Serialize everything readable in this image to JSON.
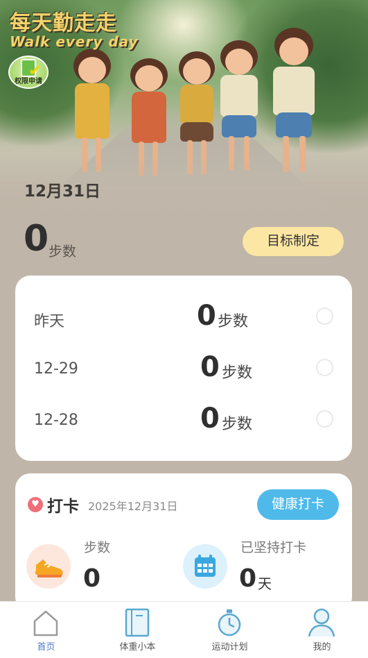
{
  "banner": {
    "title": "每天勤走走",
    "subtitle": "Walk every day",
    "permission_label": "权限申请",
    "date": "12月31日"
  },
  "today": {
    "steps": "0",
    "unit": "步数",
    "goal_button": "目标制定"
  },
  "history": [
    {
      "day": "昨天",
      "steps": "0",
      "unit": "步数"
    },
    {
      "day": "12-29",
      "steps": "0",
      "unit": "步数"
    },
    {
      "day": "12-28",
      "steps": "0",
      "unit": "步数"
    }
  ],
  "checkin": {
    "title": "打卡",
    "date": "2025年12月31日",
    "button": "健康打卡",
    "steps_label": "步数",
    "steps_value": "0",
    "streak_label": "已坚持打卡",
    "streak_value": "0",
    "streak_unit": "天"
  },
  "nav": [
    {
      "label": "首页",
      "icon": "home-icon",
      "active": true
    },
    {
      "label": "体重小本",
      "icon": "notebook-icon",
      "active": false
    },
    {
      "label": "运动计划",
      "icon": "stopwatch-icon",
      "active": false
    },
    {
      "label": "我的",
      "icon": "person-icon",
      "active": false
    }
  ],
  "colors": {
    "background": "#bfb5a8",
    "goal_button": "#fbe6a3",
    "health_button": "#4fb9ea",
    "nav_active": "#4f78c5",
    "banner_text": "#f6d26a"
  }
}
